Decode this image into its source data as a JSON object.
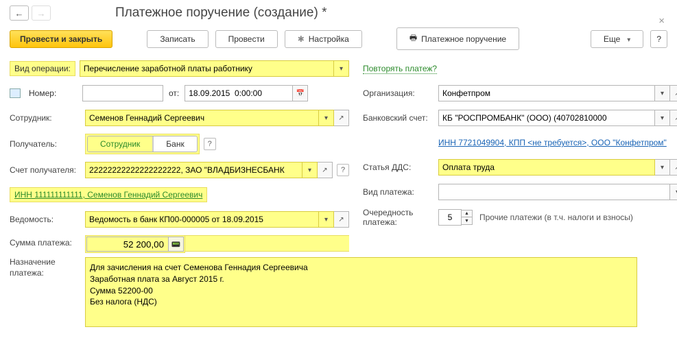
{
  "header": {
    "title": "Платежное поручение (создание) *"
  },
  "toolbar": {
    "post_close": "Провести и закрыть",
    "save": "Записать",
    "post": "Провести",
    "settings": "Настройка",
    "print": "Платежное поручение",
    "more": "Еще",
    "help": "?"
  },
  "links": {
    "repeat": "Повторять платеж?",
    "counterparty": "ИНН 7721049904, КПП <не требуется>, ООО \"Конфетпром\"",
    "employee_inn": "ИНН 111111111111, Семенов Геннадий Сергеевич"
  },
  "labels": {
    "operation": "Вид операции:",
    "number": "Номер:",
    "from": "от:",
    "employee": "Сотрудник:",
    "recipient": "Получатель:",
    "recip_account": "Счет получателя:",
    "statement": "Ведомость:",
    "amount": "Сумма платежа:",
    "purpose": "Назначение платежа:",
    "org": "Организация:",
    "bank_acc": "Банковский счет:",
    "dds": "Статья ДДС:",
    "pay_type": "Вид платежа:",
    "queue": "Очередность платежа:"
  },
  "fields": {
    "operation": "Перечисление заработной платы работнику",
    "number": "",
    "date": "18.09.2015  0:00:00",
    "employee": "Семенов Геннадий Сергеевич",
    "toggle_emp": "Сотрудник",
    "toggle_bank": "Банк",
    "recip_account": "22222222222222222222, ЗАО \"ВЛАДБИЗНЕСБАНК",
    "statement": "Ведомость в банк КП00-000005 от 18.09.2015",
    "amount": "52 200,00",
    "purpose": "Для зачисления на счет Семенова Геннадия Сергеевича\nЗаработная плата за Август 2015 г.\nСумма 52200-00\nБез налога (НДС)",
    "org": "Конфетпром",
    "bank_acc": "КБ \"РОСПРОМБАНК\" (ООО) (40702810000",
    "dds": "Оплата труда",
    "pay_type": "",
    "queue": "5",
    "queue_note": "Прочие платежи (в т.ч. налоги и взносы)"
  }
}
